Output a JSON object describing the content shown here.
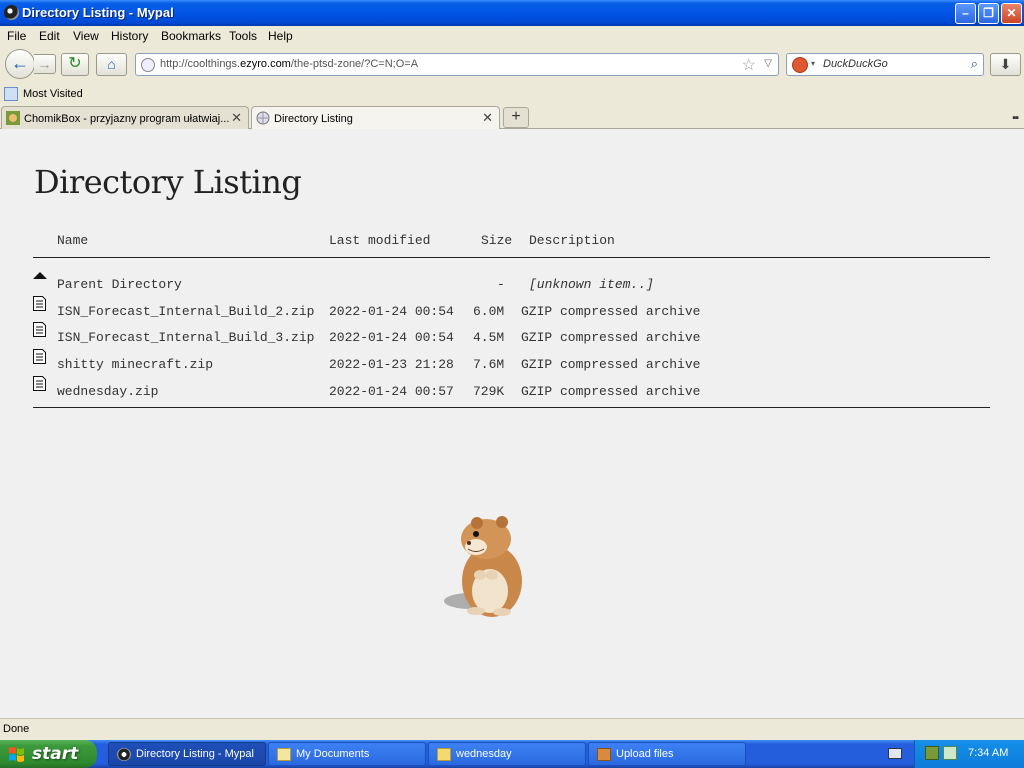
{
  "window": {
    "title": "Directory Listing - Mypal",
    "minimize": "–",
    "maximize": "❐",
    "close": "✕"
  },
  "menu": [
    "File",
    "Edit",
    "View",
    "History",
    "Bookmarks",
    "Tools",
    "Help"
  ],
  "nav": {
    "back_icon": "←",
    "forward_icon": "→",
    "reload_icon": "↻",
    "home_icon": "⌂",
    "url_prefix": "http://coolthings.",
    "url_domain": "ezyro.com",
    "url_path": "/the-ptsd-zone/?C=N;O=A",
    "star_icon": "☆",
    "dropdown_icon": "▽",
    "search_placeholder": "DuckDuckGo",
    "search_arrow": "▾",
    "search_icon": "⌕",
    "download_icon": "⬇"
  },
  "bookmarks": {
    "most_visited": "Most Visited"
  },
  "tabs": [
    {
      "label": "ChomikBox - przyjazny program ułatwiaj...",
      "close": "✕"
    },
    {
      "label": "Directory Listing",
      "close": "✕"
    }
  ],
  "new_tab": "+",
  "tab_list_icon": "▪▪",
  "page": {
    "heading": "Directory Listing",
    "columns": {
      "name": "Name",
      "modified": "Last modified",
      "size": "Size",
      "description": "Description"
    },
    "parent": {
      "name": "Parent Directory",
      "size": "-",
      "description": "[unknown item..]"
    },
    "files": [
      {
        "name": "ISN_Forecast_Internal_Build_2.zip",
        "modified": "2022-01-24 00:54",
        "size": "6.0M",
        "description": "GZIP compressed archive"
      },
      {
        "name": "ISN_Forecast_Internal_Build_3.zip",
        "modified": "2022-01-24 00:54",
        "size": "4.5M",
        "description": "GZIP compressed archive"
      },
      {
        "name": "shitty minecraft.zip",
        "modified": "2022-01-23 21:28",
        "size": "7.6M",
        "description": "GZIP compressed archive"
      },
      {
        "name": "wednesday.zip",
        "modified": "2022-01-24 00:57",
        "size": "729K",
        "description": "GZIP compressed archive"
      }
    ]
  },
  "status": "Done",
  "taskbar": {
    "start": "start",
    "tasks": [
      {
        "label": "Directory Listing - Mypal"
      },
      {
        "label": "My Documents"
      },
      {
        "label": "wednesday"
      },
      {
        "label": "Upload files"
      }
    ],
    "clock": "7:34 AM"
  },
  "colors": {
    "titlebar": "#0055E5",
    "page_bg": "#F0F0F0",
    "taskbar": "#245EDC",
    "start": "#3C9A3C"
  }
}
